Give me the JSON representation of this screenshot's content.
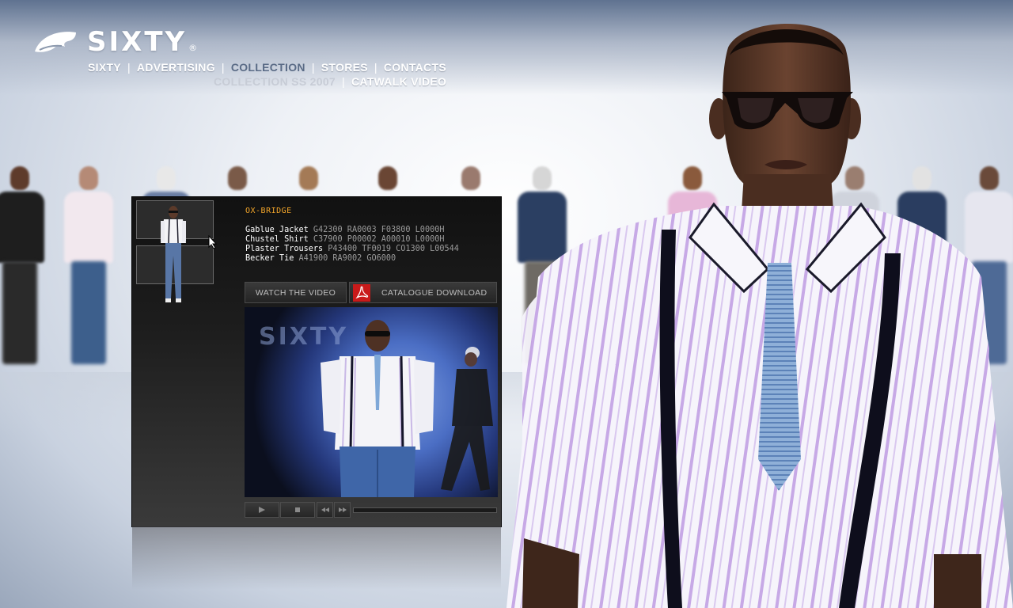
{
  "brand": {
    "name": "SIXTY",
    "registered": "®"
  },
  "nav": {
    "items": [
      {
        "label": "SIXTY",
        "active": false
      },
      {
        "label": "ADVERTISING",
        "active": false
      },
      {
        "label": "COLLECTION",
        "active": true
      },
      {
        "label": "STORES",
        "active": false
      },
      {
        "label": "CONTACTS",
        "active": false
      }
    ],
    "separator": "|"
  },
  "subnav": {
    "items": [
      {
        "label": "COLLECTION SS 2007",
        "dim": true
      },
      {
        "label": "CATWALK VIDEO",
        "dim": false
      }
    ]
  },
  "look": {
    "title": "OX-BRIDGE",
    "items": [
      {
        "name": "Gablue Jacket",
        "codes": "G42300 RA0003 F03800 L0000H"
      },
      {
        "name": "Chustel Shirt",
        "codes": "C37900 P00002 A00010 L0000H"
      },
      {
        "name": "Plaster Trousers",
        "codes": "P43400 TF0019 CO1300 L00544"
      },
      {
        "name": "Becker Tie",
        "codes": "A41900 RA9002 GO6000"
      }
    ]
  },
  "buttons": {
    "watch_video": "WATCH THE VIDEO",
    "catalogue_download": "CATALOGUE DOWNLOAD"
  },
  "video": {
    "watermark": "SIXTY",
    "progress": 0
  },
  "colors": {
    "accent_orange": "#f2a52a",
    "nav_active": "#5a6b86",
    "panel_bg": "#1d1d1d"
  }
}
